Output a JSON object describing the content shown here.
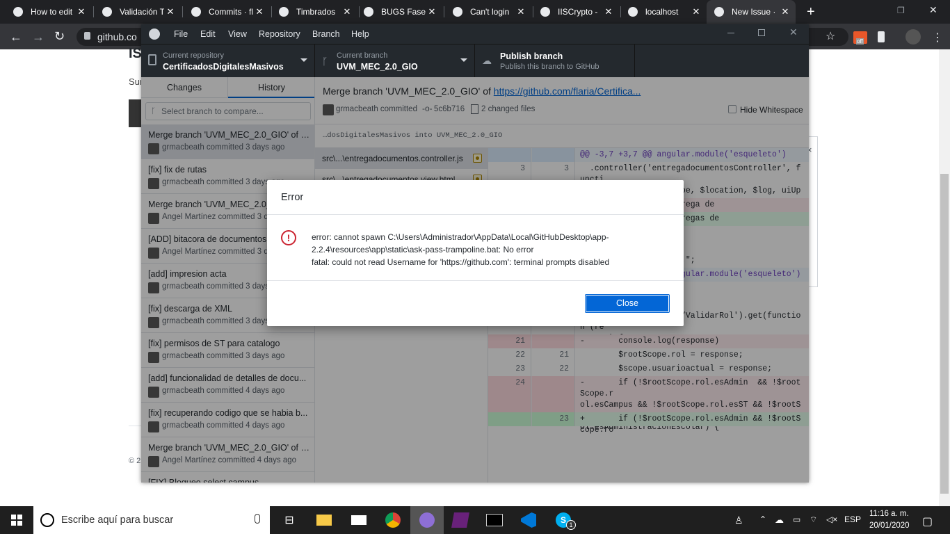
{
  "browser": {
    "tabs": [
      {
        "title": "How to edit",
        "icon": "bl-icon",
        "active": false
      },
      {
        "title": "Validación T",
        "icon": "globe-icon",
        "active": false
      },
      {
        "title": "Commits · fl",
        "icon": "github-icon",
        "active": false
      },
      {
        "title": "Timbrados",
        "icon": "hex-icon",
        "active": false
      },
      {
        "title": "BUGS Fase",
        "icon": "trello-icon",
        "active": false
      },
      {
        "title": "Can't login",
        "icon": "github-icon",
        "active": false
      },
      {
        "title": "IISCrypto -",
        "icon": "google-icon",
        "active": false
      },
      {
        "title": "localhost",
        "icon": "globe-icon",
        "active": false
      },
      {
        "title": "New Issue ·",
        "icon": "github-icon",
        "active": true
      }
    ],
    "url": "github.co",
    "extension_badge": "off"
  },
  "background_page": {
    "heading": "IS",
    "sub": "Sur",
    "footer": "© 2"
  },
  "app": {
    "menu": [
      "File",
      "Edit",
      "View",
      "Repository",
      "Branch",
      "Help"
    ],
    "repo": {
      "label": "Current repository",
      "value": "CertificadosDigitalesMasivos"
    },
    "branch": {
      "label": "Current branch",
      "value": "UVM_MEC_2.0_GIO"
    },
    "publish": {
      "label": "Publish branch",
      "sub": "Publish this branch to GitHub"
    },
    "tabs": {
      "changes": "Changes",
      "history": "History"
    },
    "branch_compare_placeholder": "Select branch to compare...",
    "commits": [
      {
        "message": "Merge branch 'UVM_MEC_2.0_GIO' of ht...",
        "meta": "grmacbeath committed 3 days ago",
        "selected": true
      },
      {
        "message": "[fix] fix de rutas",
        "meta": "grmacbeath committed 3 days ago"
      },
      {
        "message": "Merge branch 'UVM_MEC_2.0_G...",
        "meta": "Angel Martínez committed 3 days ago"
      },
      {
        "message": "[ADD] bitacora de documentos",
        "meta": "Angel Martínez committed 3 days ago"
      },
      {
        "message": "[add] impresion acta",
        "meta": "grmacbeath committed 3 days ago"
      },
      {
        "message": "[fix] descarga de XML",
        "meta": "grmacbeath committed 3 days ago"
      },
      {
        "message": "[fix] permisos de ST para catalogo",
        "meta": "grmacbeath committed 3 days ago"
      },
      {
        "message": "[add] funcionalidad de detalles de docu...",
        "meta": "grmacbeath committed 4 days ago"
      },
      {
        "message": "[fix] recuperando codigo que se habia b...",
        "meta": "grmacbeath committed 4 days ago"
      },
      {
        "message": "Merge branch 'UVM_MEC_2.0_GIO' of ht...",
        "meta": "Angel Martínez committed 4 days ago"
      },
      {
        "message": "[FIX] Bloqueo select campus",
        "meta": ""
      }
    ],
    "commit_detail": {
      "title": "Merge branch 'UVM_MEC_2.0_GIO' of ",
      "link": "https://github.com/flaria/Certifica...",
      "author": "grmacbeath committed",
      "sha": "5c6b716",
      "changed": "2 changed files",
      "hide_whitespace": "Hide Whitespace",
      "description": "…dosDigitalesMasivos into UVM_MEC_2.0_GIO"
    },
    "files": [
      "src\\...\\entregadocumentos.controller.js",
      "src\\...\\entregadocumentos.view.html"
    ],
    "diff": [
      {
        "kind": "hunk",
        "a": "",
        "b": "",
        "text": "@@ -3,7 +3,7 @@ angular.module('esqueleto')"
      },
      {
        "kind": "ctx",
        "a": "3",
        "b": "3",
        "text": "  .controller('entregadocumentosController', functi\n  on($scope, $rootScope, $location, $log, uiUploader,\n  $window, MyGrid, Resource,"
      },
      {
        "kind": "del",
        "a": "",
        "b": "",
        "text": "  ina = \"Consulta Entrega de"
      },
      {
        "kind": "add",
        "a": "",
        "b": "",
        "text": "  ina = \"Consulta Entregas de"
      },
      {
        "kind": "ctx",
        "a": "",
        "b": "",
        "text": "  ;"
      },
      {
        "kind": "ctx",
        "a": "",
        "b": "",
        "text": "  isplay: none;\";"
      },
      {
        "kind": "ctx",
        "a": "",
        "b": "",
        "text": "  es = \"display: none;\";"
      },
      {
        "kind": "hunk",
        "a": "",
        "b": "",
        "text": "@@ -18,10 +18,9 @@ angular.module('esqueleto')"
      },
      {
        "kind": "ctx",
        "a": "18",
        "b": "18",
        "text": "    });"
      },
      {
        "kind": "ctx",
        "a": "19",
        "b": "19",
        "text": ""
      },
      {
        "kind": "ctx",
        "a": "20",
        "b": "20",
        "text": "    Resource.api('api/ValidarRol').get(function (re\nsponse) {"
      },
      {
        "kind": "del",
        "a": "21",
        "b": "",
        "text": "-       console.log(response)"
      },
      {
        "kind": "ctx",
        "a": "22",
        "b": "21",
        "text": "        $rootScope.rol = response;"
      },
      {
        "kind": "ctx",
        "a": "23",
        "b": "22",
        "text": "        $scope.usuarioactual = response;"
      },
      {
        "kind": "del",
        "a": "24",
        "b": "",
        "text": "-       if (!$rootScope.rol.esAdmin  && !$rootScope.r\nol.esCampus && !$rootScope.rol.esST && !$rootScope.r\nol.esAdministracionEscolar) {"
      },
      {
        "kind": "add",
        "a": "",
        "b": "23",
        "text": "+       if (!$rootScope.rol.esAdmin && !$rootScope.ro"
      }
    ]
  },
  "dialog": {
    "title": "Error",
    "line1": "error: cannot spawn C:\\Users\\Administrador\\AppData\\Local\\GitHubDesktop\\app-",
    "line2": "2.2.4\\resources\\app\\static\\ask-pass-trampoline.bat: No error",
    "line3": "fatal: could not read Username for 'https://github.com': terminal prompts disabled",
    "close": "Close"
  },
  "taskbar": {
    "search_placeholder": "Escribe aquí para buscar",
    "lang": "ESP",
    "time": "11:16 a. m.",
    "date": "20/01/2020",
    "skype_badge": "1"
  },
  "colors": {
    "accent": "#0366d6",
    "dark": "#24292e",
    "error": "#cb2431"
  }
}
